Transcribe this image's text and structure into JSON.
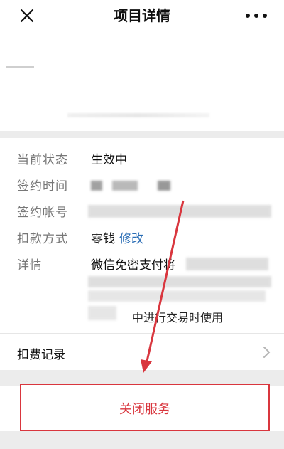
{
  "header": {
    "title": "项目详情"
  },
  "details": {
    "status": {
      "label": "当前状态",
      "value": "生效中"
    },
    "signed_time": {
      "label": "签约时间"
    },
    "account": {
      "label": "签约帐号"
    },
    "payment_method": {
      "label": "扣款方式",
      "value": "零钱",
      "link": "修改"
    },
    "description": {
      "label": "详情",
      "line1": "微信免密支付将",
      "line2": "中进行交易时使用"
    }
  },
  "records": {
    "label": "扣费记录"
  },
  "action": {
    "close_service": "关闭服务"
  },
  "colors": {
    "accent_red": "#d9363e",
    "link_blue": "#2a6db5"
  }
}
